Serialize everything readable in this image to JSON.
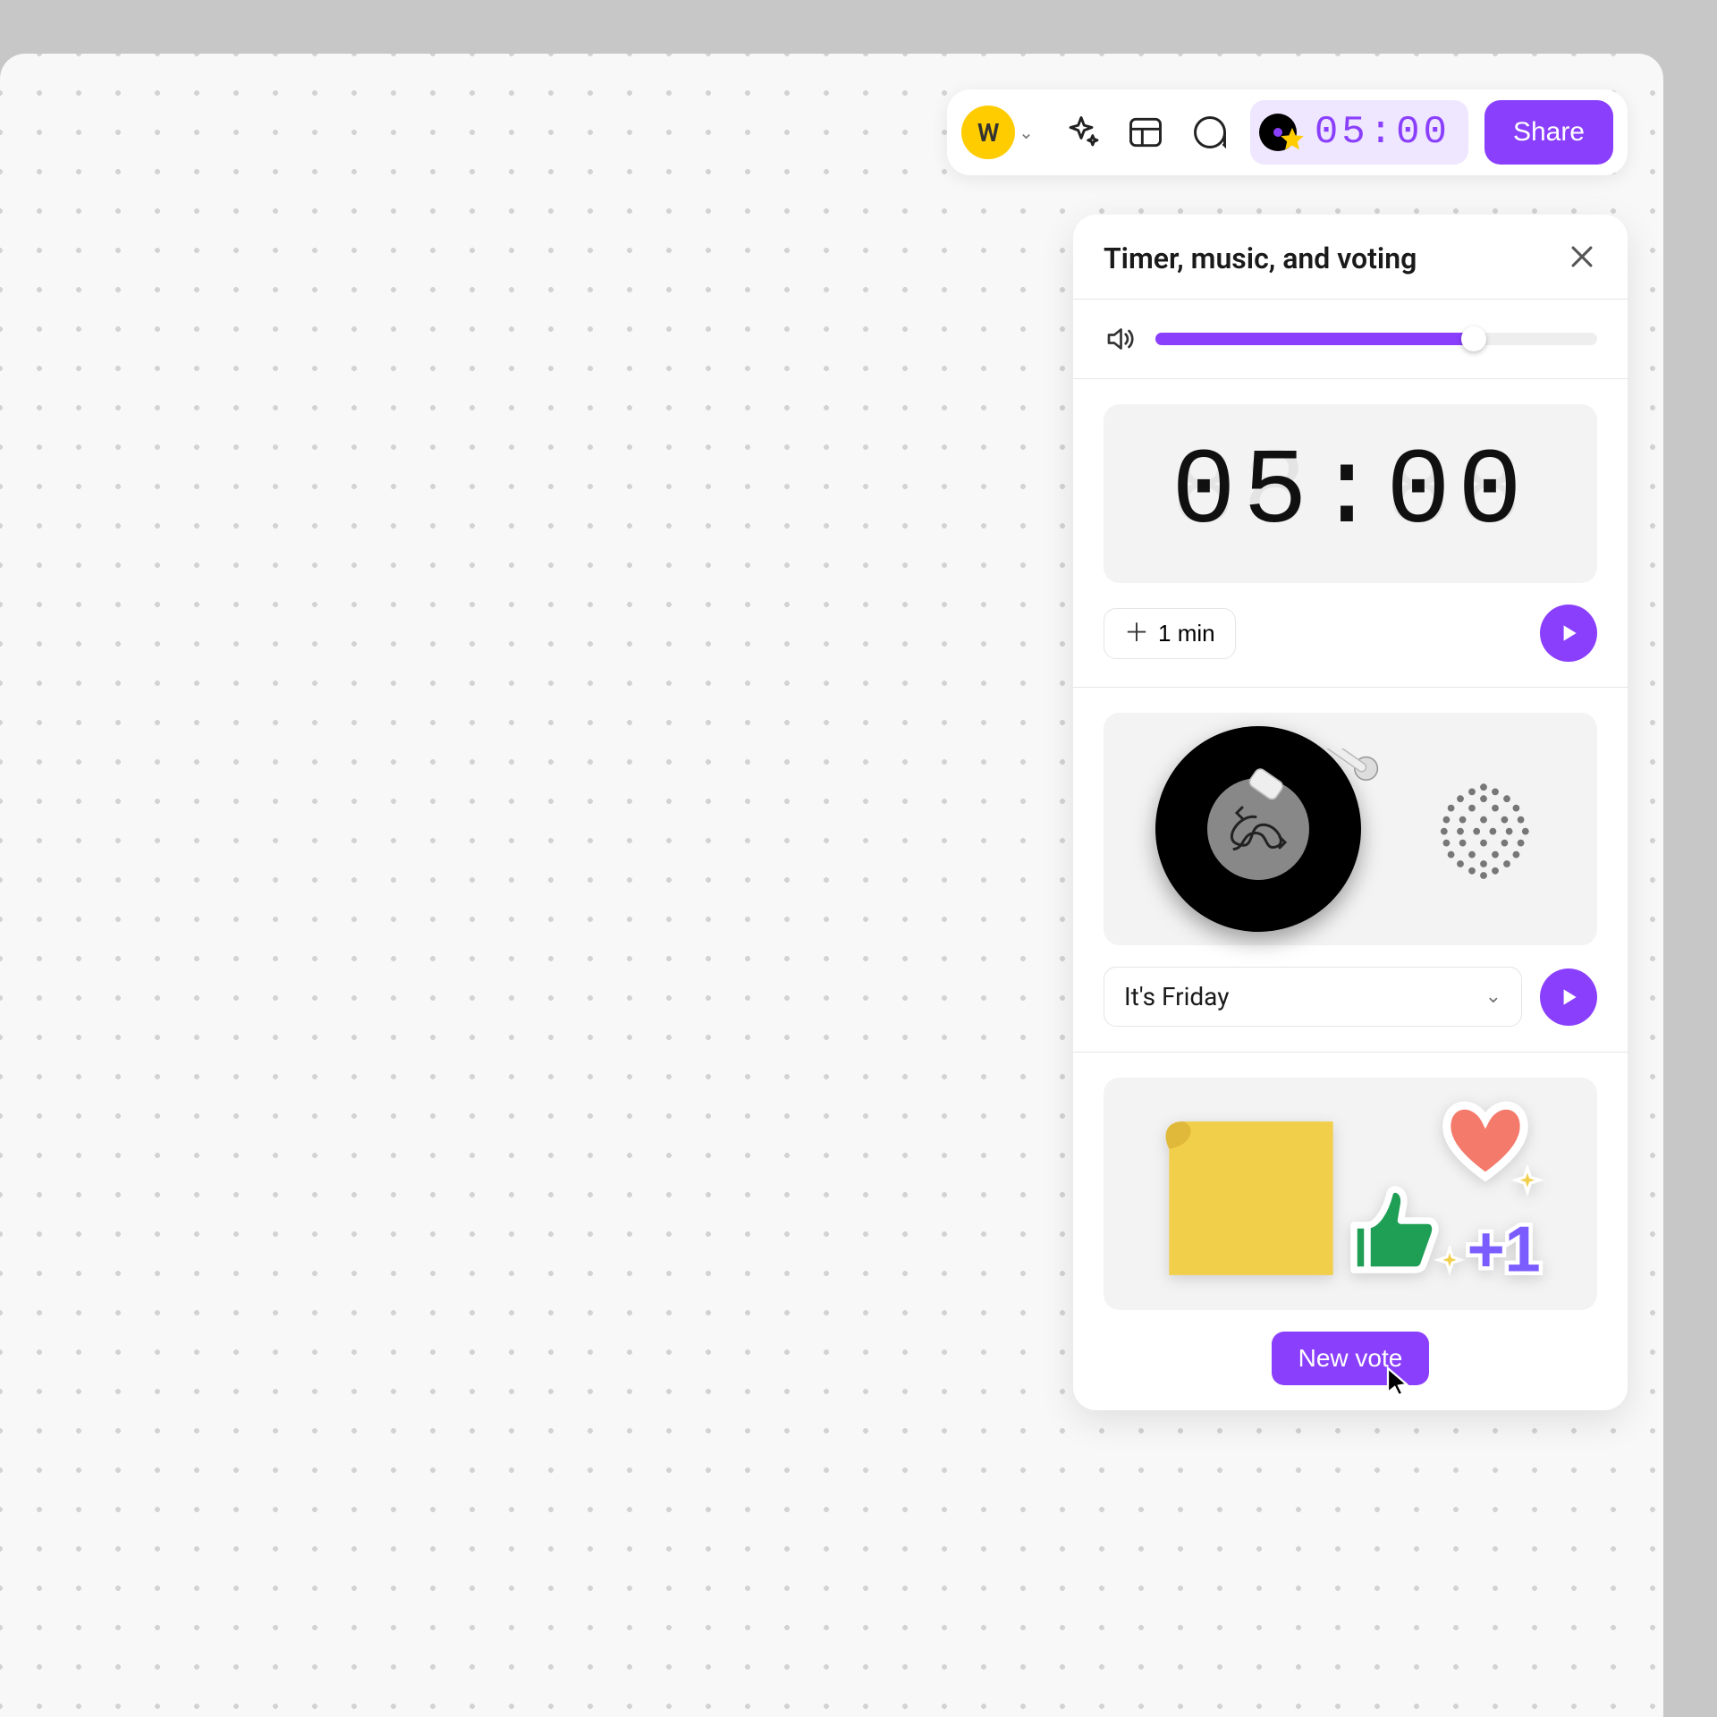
{
  "toolbar": {
    "avatar_initial": "W",
    "timer": "05:00",
    "share_label": "Share"
  },
  "panel": {
    "title": "Timer, music, and voting",
    "volume_percent": 72,
    "timer": {
      "display": "05:00",
      "add_minute_label": "1 min"
    },
    "music": {
      "track": "It's Friday"
    },
    "voting": {
      "button_label": "New vote"
    }
  },
  "colors": {
    "accent": "#8a3ffc",
    "accent_light": "#efe6ff",
    "avatar": "#ffcc00"
  }
}
